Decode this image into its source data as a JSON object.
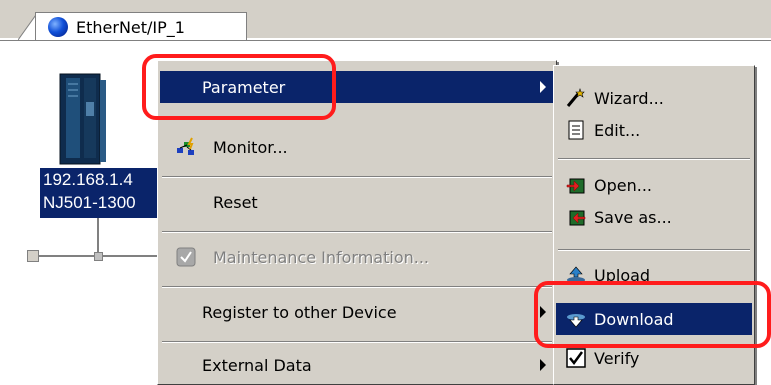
{
  "tab": {
    "label": "EtherNet/IP_1"
  },
  "device": {
    "ip": "192.168.1.4",
    "model": "NJ501-1300"
  },
  "context_menu": {
    "parameter": "Parameter",
    "monitor": "Monitor...",
    "reset": "Reset",
    "maintenance": "Maintenance Information...",
    "register": "Register to other Device",
    "external_data": "External Data"
  },
  "submenu": {
    "wizard": "Wizard...",
    "edit": "Edit...",
    "open": "Open...",
    "save_as": "Save as...",
    "upload": "Upload",
    "download": "Download",
    "verify": "Verify"
  },
  "colors": {
    "highlight": "#0a246a",
    "menu_bg": "#d4d0c8",
    "annotation": "#ff1c1c"
  }
}
